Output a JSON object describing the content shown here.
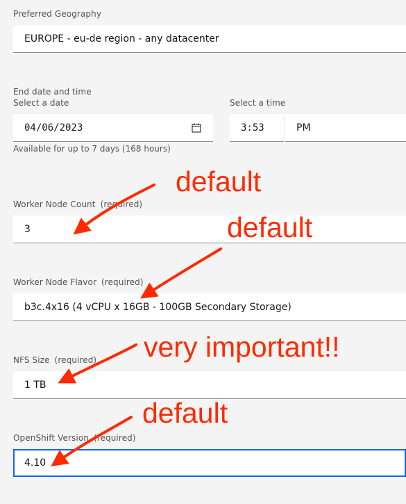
{
  "geography": {
    "label": "Preferred Geography",
    "value": "EUROPE - eu-de region - any datacenter"
  },
  "end_datetime": {
    "section_label": "End date and time",
    "date_label": "Select a date",
    "date_value": "04/06/2023",
    "time_label": "Select a time",
    "time_value": "3:53",
    "ampm_value": "PM",
    "helper": "Available for up to 7 days (168 hours)"
  },
  "worker_count": {
    "label": "Worker Node Count",
    "required": "(required)",
    "value": "3"
  },
  "worker_flavor": {
    "label": "Worker Node Flavor",
    "required": "(required)",
    "value": "b3c.4x16 (4 vCPU x 16GB - 100GB Secondary Storage)"
  },
  "nfs_size": {
    "label": "NFS Size",
    "required": "(required)",
    "value": "1 TB"
  },
  "openshift_version": {
    "label": "OpenShift Version",
    "required": "(required)",
    "value": "4.10"
  },
  "annotations": {
    "a1": "default",
    "a2": "default",
    "a3": "very important!!",
    "a4": "default"
  },
  "colors": {
    "annotation": "#ff2a00",
    "focus": "#0f62fe",
    "background": "#f4f4f4"
  }
}
